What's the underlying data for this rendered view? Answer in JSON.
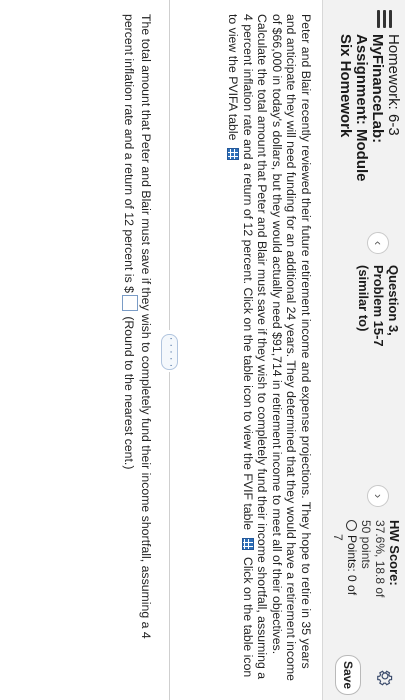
{
  "header": {
    "title_lines": [
      "Homework: 6-3",
      "MyFinanceLab:",
      "Assignment: Module",
      "Six Homework"
    ],
    "question_lines": [
      "Question 3,",
      "Problem 15-7",
      "(similar to)"
    ],
    "hw_score_label": "HW Score:",
    "hw_score_value": "37.6%, 18.8 of",
    "hw_score_points": "50 points",
    "points_text": "Points: 0 of",
    "points_total": "7",
    "save_label": "Save",
    "prev_icon": "‹",
    "next_icon": "›"
  },
  "problem": {
    "text_main": "Peter and Blair recently reviewed their future retirement income and expense projections. They hope to retire in 35 years and anticipate they will need funding for an additional 24 years. They determined that they would have a retirement income of $66,000 in today's dollars, but they would actually need $91,714 in retirement income to meet all of their objectives. Calculate the total amount that Peter and Blair must save if they wish to completely fund their income shortfall, assuming a 4 percent inflation rate and a return of 12 percent. Click on the table icon to view the FVIF table",
    "text_link": "Click on the table icon to view the PVIFA table"
  },
  "ellipsis": "· · · · ·",
  "question": {
    "text_before": "The total amount that Peter and Blair must save if they wish to completely fund their income shortfall, assuming a 4 percent inflation rate and a return of 12 percent is $",
    "text_after": "(Round to the nearest cent.)"
  },
  "colors": {
    "header_bg": "#f2f2f2",
    "table_icon": "#2e6fb8",
    "answer_border": "#7a9cc6"
  }
}
